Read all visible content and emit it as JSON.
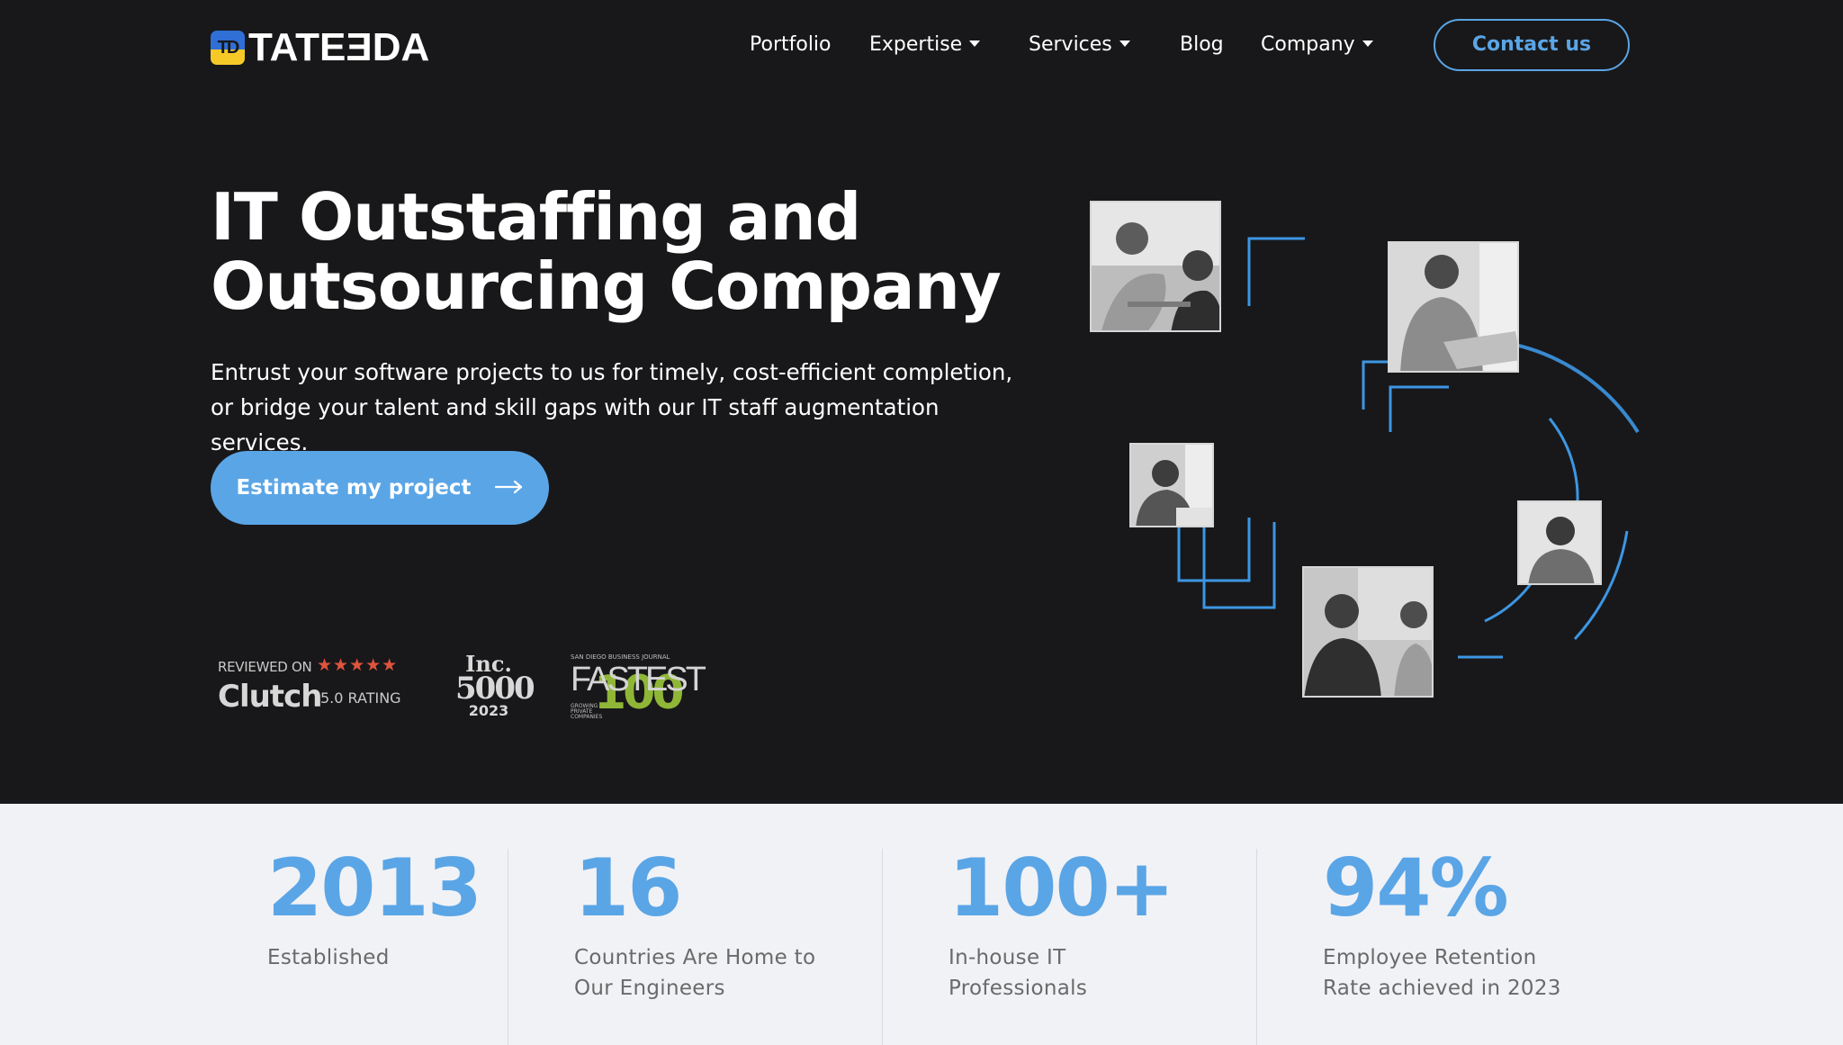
{
  "header": {
    "logo_text": "TATEƎDA",
    "logo_mark_text": "TD",
    "nav": [
      {
        "label": "Portfolio",
        "dropdown": false
      },
      {
        "label": "Expertise",
        "dropdown": true
      },
      {
        "label": "Services",
        "dropdown": true
      },
      {
        "label": "Blog",
        "dropdown": false
      },
      {
        "label": "Company",
        "dropdown": true
      }
    ],
    "contact_label": "Contact us"
  },
  "hero": {
    "title_line1": "IT Outstaffing and",
    "title_line2": "Outsourcing Company",
    "subtitle": "Entrust your software projects to us for timely, cost-efficient completion, or bridge your talent and skill gaps with our IT staff augmentation services.",
    "cta_label": "Estimate my project",
    "cta_arrow": "⟶"
  },
  "badges": {
    "clutch": {
      "reviewed": "REVIEWED ON",
      "stars": "★★★★★",
      "name": "Clutch",
      "rating": "5.0 RATING"
    },
    "inc": {
      "line1": "Inc.",
      "line2": "5000",
      "line3": "2023"
    },
    "fastest": {
      "header": "SAN DIEGO BUSINESS JOURNAL",
      "word": "FASTEST",
      "number": "100",
      "small": "GROWING PRIVATE COMPANIES"
    }
  },
  "stats": [
    {
      "value": "2013",
      "label_lines": [
        "Established"
      ]
    },
    {
      "value": "16",
      "label_lines": [
        "Countries Are Home to",
        "Our Engineers"
      ]
    },
    {
      "value": "100+",
      "label_lines": [
        "In-house IT",
        "Professionals"
      ]
    },
    {
      "value": "94%",
      "label_lines": [
        "Employee Retention",
        "Rate achieved in 2023"
      ]
    }
  ],
  "colors": {
    "hero_bg": "#18181a",
    "accent": "#5aa5e6",
    "stats_bg": "#f1f2f6",
    "logo_blue": "#2f6fd6",
    "logo_yellow": "#f6c928"
  }
}
